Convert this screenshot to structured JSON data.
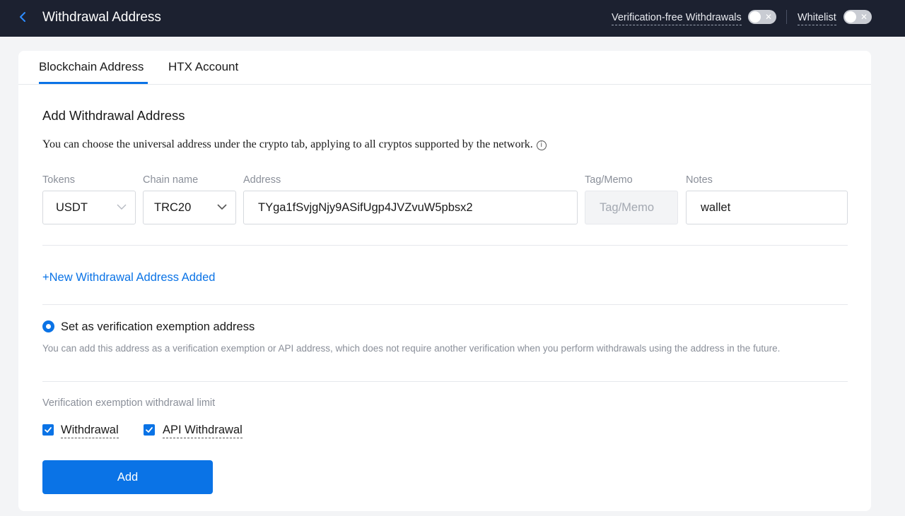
{
  "header": {
    "back_icon": "chevron-left-icon",
    "title": "Withdrawal Address",
    "verification_free_label": "Verification-free Withdrawals",
    "verification_free_on": false,
    "whitelist_label": "Whitelist",
    "whitelist_on": false,
    "toggle_off_glyph": "✕"
  },
  "tabs": [
    {
      "label": "Blockchain Address",
      "active": true
    },
    {
      "label": "HTX Account",
      "active": false
    }
  ],
  "form": {
    "heading": "Add Withdrawal Address",
    "description": "You can choose the universal address under the crypto tab, applying to all cryptos supported by the network.",
    "info_glyph": "i",
    "fields": {
      "tokens": {
        "label": "Tokens",
        "value": "USDT"
      },
      "chain": {
        "label": "Chain name",
        "value": "TRC20"
      },
      "address": {
        "label": "Address",
        "value": "TYga1fSvjgNjy9ASifUgp4JVZvuW5pbsx2"
      },
      "tag": {
        "label": "Tag/Memo",
        "placeholder": "Tag/Memo"
      },
      "notes": {
        "label": "Notes",
        "value": "wallet"
      }
    },
    "new_address_link": "+New Withdrawal Address Added",
    "exemption": {
      "label": "Set as verification exemption address",
      "selected": true,
      "help": "You can add this address as a verification exemption or API address, which does not require another verification when you perform withdrawals using the address in the future."
    },
    "limit": {
      "label": "Verification exemption withdrawal limit",
      "options": [
        {
          "label": "Withdrawal",
          "checked": true
        },
        {
          "label": "API Withdrawal",
          "checked": true
        }
      ]
    },
    "submit_label": "Add"
  },
  "colors": {
    "topbar": "#1c2130",
    "accent": "#0a73e6",
    "muted_text": "#8a8f99"
  }
}
